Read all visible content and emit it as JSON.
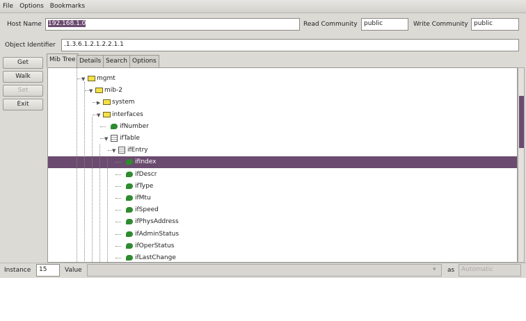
{
  "menu": [
    "File",
    "Options",
    "Bookmarks"
  ],
  "host": {
    "label": "Host Name",
    "value": "192.168.1.0"
  },
  "read": {
    "label": "Read Community",
    "value": "public"
  },
  "write": {
    "label": "Write Community",
    "value": "public"
  },
  "oid": {
    "label": "Object Identifier",
    "value": ".1.3.6.1.2.1.2.2.1.1"
  },
  "buttons": [
    "Get",
    "Walk",
    "Set",
    "Exit"
  ],
  "tabs": [
    "Mib Tree",
    "Details",
    "Search",
    "Options"
  ],
  "tree": [
    {
      "label": "mgmt",
      "level": 0,
      "type": "folder",
      "expanded": true
    },
    {
      "label": "mib-2",
      "level": 1,
      "type": "folder",
      "expanded": true
    },
    {
      "label": "system",
      "level": 2,
      "type": "folder",
      "expanded": false
    },
    {
      "label": "interfaces",
      "level": 2,
      "type": "folder",
      "expanded": true
    },
    {
      "label": "ifNumber",
      "level": 3,
      "type": "leaf"
    },
    {
      "label": "ifTable",
      "level": 3,
      "type": "table",
      "expanded": true
    },
    {
      "label": "ifEntry",
      "level": 4,
      "type": "table",
      "expanded": true
    },
    {
      "label": "ifIndex",
      "level": 5,
      "type": "leaf",
      "selected": true
    },
    {
      "label": "ifDescr",
      "level": 5,
      "type": "leaf"
    },
    {
      "label": "ifType",
      "level": 5,
      "type": "leaf"
    },
    {
      "label": "ifMtu",
      "level": 5,
      "type": "leaf"
    },
    {
      "label": "ifSpeed",
      "level": 5,
      "type": "leaf"
    },
    {
      "label": "ifPhysAddress",
      "level": 5,
      "type": "leaf"
    },
    {
      "label": "ifAdminStatus",
      "level": 5,
      "type": "leaf"
    },
    {
      "label": "ifOperStatus",
      "level": 5,
      "type": "leaf"
    },
    {
      "label": "ifLastChange",
      "level": 5,
      "type": "leaf"
    }
  ],
  "bottom": {
    "instance_label": "Instance",
    "instance_value": "15",
    "value_label": "Value",
    "value": "",
    "as_label": "as",
    "as_value": "Automatic"
  }
}
